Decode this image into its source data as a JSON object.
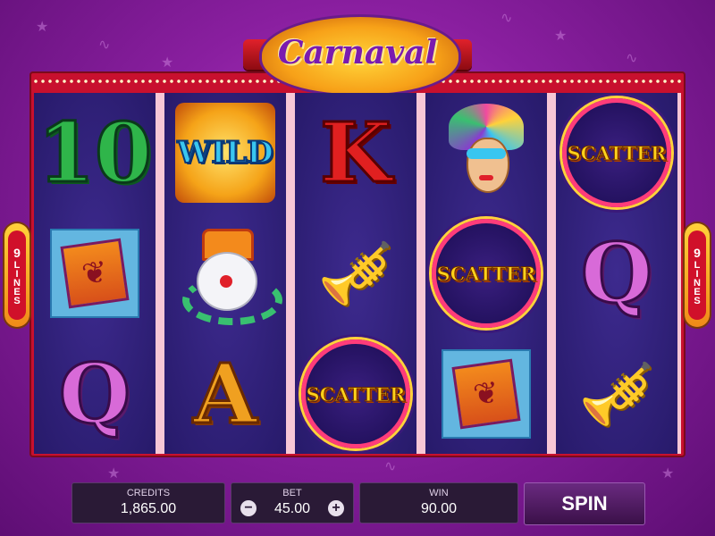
{
  "game": {
    "logo": "Carnaval",
    "paylines_badge": {
      "number": "9",
      "word": "LINES"
    }
  },
  "reels": [
    {
      "symbols": [
        {
          "type": "number",
          "label": "10"
        },
        {
          "type": "flag",
          "label": ""
        },
        {
          "type": "queen",
          "label": "Q"
        }
      ]
    },
    {
      "symbols": [
        {
          "type": "wild",
          "label": "WILD"
        },
        {
          "type": "clown",
          "label": ""
        },
        {
          "type": "ace",
          "label": "A"
        }
      ]
    },
    {
      "symbols": [
        {
          "type": "king",
          "label": "K"
        },
        {
          "type": "trumpet",
          "label": ""
        },
        {
          "type": "scatter",
          "label": "SCATTER"
        }
      ]
    },
    {
      "symbols": [
        {
          "type": "dancer",
          "label": ""
        },
        {
          "type": "scatter",
          "label": "SCATTER"
        },
        {
          "type": "flag",
          "label": ""
        }
      ]
    },
    {
      "symbols": [
        {
          "type": "scatter",
          "label": "SCATTER"
        },
        {
          "type": "queen",
          "label": "Q"
        },
        {
          "type": "trumpet",
          "label": ""
        }
      ]
    }
  ],
  "controls": {
    "credits_label": "CREDITS",
    "credits_value": "1,865.00",
    "bet_label": "BET",
    "bet_value": "45.00",
    "bet_decrease": "−",
    "bet_increase": "+",
    "win_label": "WIN",
    "win_value": "90.00",
    "spin_label": "SPIN"
  },
  "colors": {
    "background": "#8a1fa0",
    "frame": "#c8102e",
    "reel": "#2b1c70"
  }
}
